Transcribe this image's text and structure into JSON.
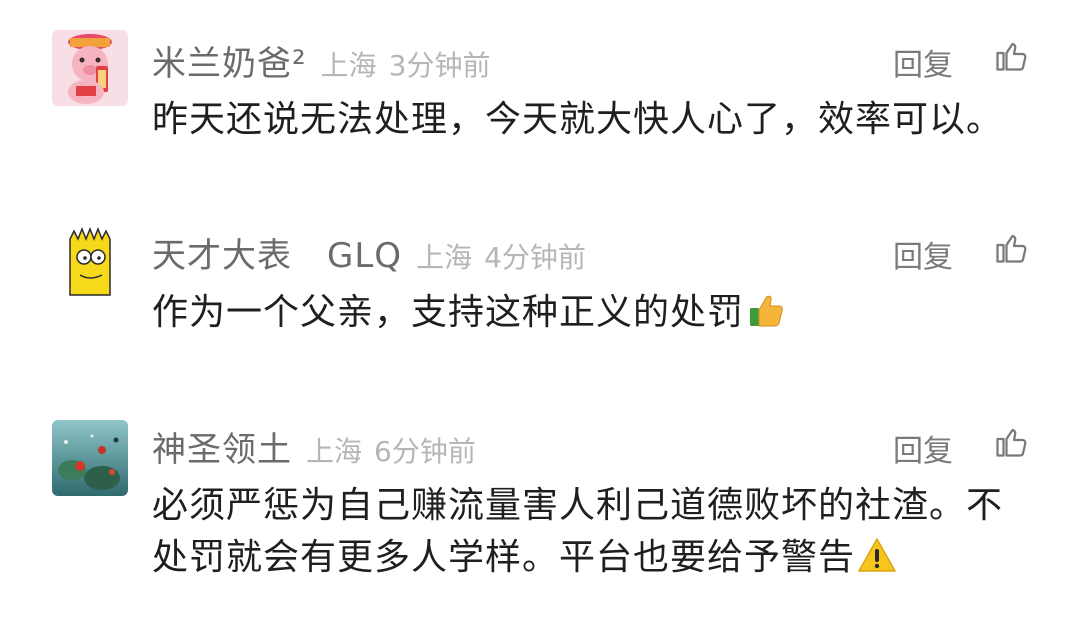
{
  "comments": [
    {
      "username": "米兰奶爸²",
      "location": "上海",
      "time": "3分钟前",
      "reply_label": "回复",
      "text": "昨天还说无法处理，今天就大快人心了，效率可以。",
      "avatar_icon": "pink-cartoon-character-avatar"
    },
    {
      "username": "天才大表　GLQ",
      "location": "上海",
      "time": "4分钟前",
      "reply_label": "回复",
      "text": "作为一个父亲，支持这种正义的处罚",
      "emoji": "thumbs-up-emoji",
      "avatar_icon": "yellow-cartoon-character-avatar"
    },
    {
      "username": "神圣领土",
      "location": "上海",
      "time": "6分钟前",
      "reply_label": "回复",
      "text_line1": "必须严惩为自己赚流量害人利己道德败坏的社渣。不",
      "text_line2": "处罚就会有更多人学样。平台也要给予警告",
      "emoji": "warning-emoji",
      "avatar_icon": "underwater-scene-avatar"
    }
  ],
  "colors": {
    "username": "#6b6b6b",
    "meta": "#b6b6b6",
    "text": "#1f1f1f",
    "reply": "#7a7a7a"
  }
}
